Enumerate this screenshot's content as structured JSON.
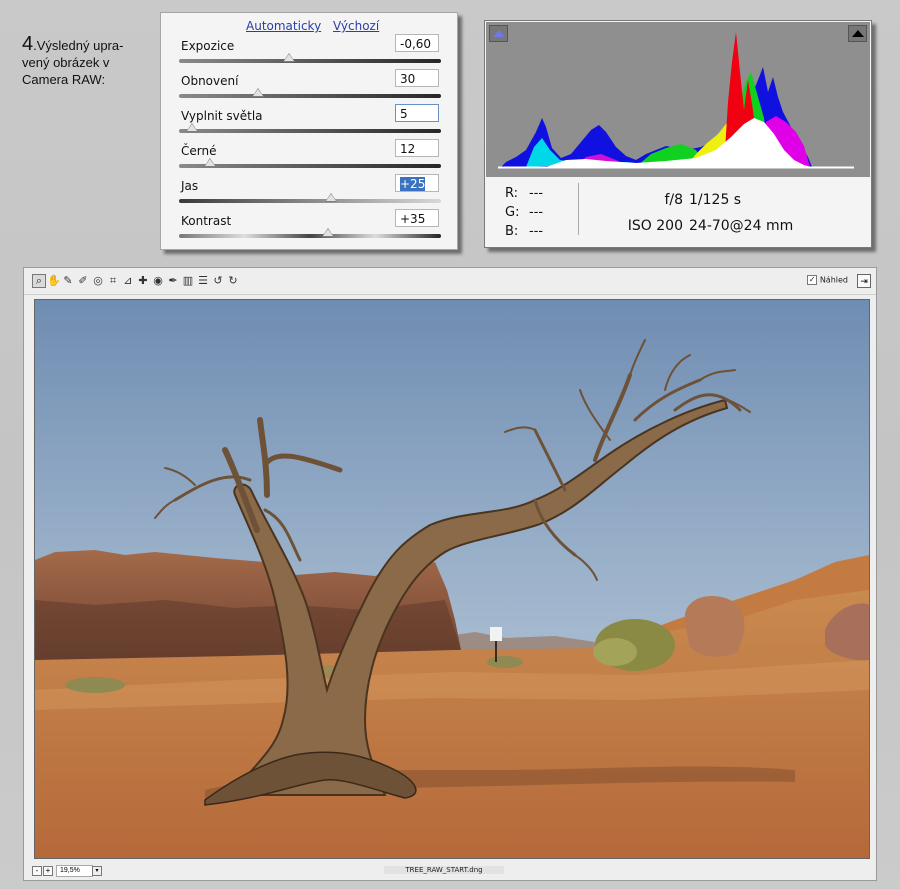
{
  "caption": {
    "number": "4",
    "text": ".Výsledný upra-\nvený  obrázek v\nCamera RAW:"
  },
  "panel": {
    "links": {
      "auto": "Automaticky",
      "default": "Výchozí"
    },
    "sliders": [
      {
        "label": "Expozice",
        "value": "-0,60",
        "position": 0.42
      },
      {
        "label": "Obnovení",
        "value": "30",
        "position": 0.3
      },
      {
        "label": "Vyplnit světla",
        "value": "5",
        "position": 0.05
      },
      {
        "label": "Černé",
        "value": "12",
        "position": 0.12
      },
      {
        "label": "Jas",
        "value": "+25",
        "position": 0.58
      },
      {
        "label": "Kontrast",
        "value": "+35",
        "position": 0.57
      }
    ]
  },
  "histogram": {
    "readout": [
      {
        "channel": "R:",
        "value": "---"
      },
      {
        "channel": "G:",
        "value": "---"
      },
      {
        "channel": "B:",
        "value": "---"
      }
    ],
    "exif": {
      "aperture": "f/8",
      "shutter": "1/125 s",
      "iso": "ISO 200",
      "lens": "24-70@24 mm"
    }
  },
  "editor": {
    "toolbar_icons": [
      "zoom-icon",
      "hand-icon",
      "white-balance-icon",
      "color-sampler-icon",
      "target-adjust-icon",
      "crop-icon",
      "straighten-icon",
      "spot-removal-icon",
      "red-eye-icon",
      "adjustment-brush-icon",
      "graduated-filter-icon",
      "preferences-icon",
      "rotate-left-icon",
      "rotate-right-icon"
    ],
    "toolbar_glyphs": [
      "⌕",
      "✋",
      "✎",
      "✐",
      "◎",
      "⌗",
      "⊿",
      "✚",
      "◉",
      "✒",
      "▥",
      "☰",
      "↺",
      "↻"
    ],
    "preview_label": "Náhled",
    "preview_checked": "✓",
    "fullscreen_glyph": "⇥",
    "zoom_out": "-",
    "zoom_in": "+",
    "zoom_value": "19,5%",
    "zoom_dropdown": "▾",
    "filename": "TREE_RAW_START.dng"
  }
}
